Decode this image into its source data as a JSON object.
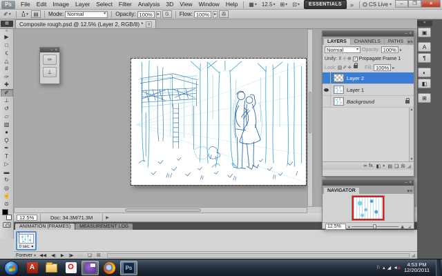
{
  "app": {
    "logo": "Ps",
    "menus": [
      "File",
      "Edit",
      "Image",
      "Layer",
      "Select",
      "Filter",
      "Analysis",
      "3D",
      "View",
      "Window",
      "Help"
    ],
    "zoom_level": "12.5",
    "bar_icons": [
      {
        "name": "view-extras-icon",
        "glyph": "▦"
      },
      {
        "name": "arrange-documents-icon",
        "glyph": "⊞"
      },
      {
        "name": "screen-mode-icon",
        "glyph": "⊡"
      }
    ],
    "workspace": "ESSENTIALS",
    "overflow": "»",
    "cslive": "CS Live",
    "window": {
      "minimize": "–",
      "restore": "❐",
      "close": "×"
    }
  },
  "options": {
    "brush_size": "11",
    "mode_label": "Mode:",
    "mode_value": "Normal",
    "opacity_label": "Opacity:",
    "opacity_value": "100%",
    "flow_label": "Flow:",
    "flow_value": "100%",
    "brush_glyph": "✐",
    "panel_toggle_glyph": "▤",
    "airbrush_glyph": "✇",
    "pressure_glyph": "⍉"
  },
  "doc_tab": {
    "title": "Composite rough.psd @ 12.5% (Layer 2, RGB/8) *",
    "close": "×"
  },
  "tools": [
    {
      "name": "move-tool",
      "glyph": "▶"
    },
    {
      "name": "marquee-tool",
      "glyph": "□"
    },
    {
      "name": "lasso-tool",
      "glyph": "ς"
    },
    {
      "name": "quick-selection-tool",
      "glyph": "△"
    },
    {
      "name": "crop-tool",
      "glyph": "#"
    },
    {
      "name": "eyedropper-tool",
      "glyph": "✑"
    },
    {
      "name": "healing-brush-tool",
      "glyph": "✚"
    },
    {
      "name": "brush-tool",
      "glyph": "✐"
    },
    {
      "name": "clone-stamp-tool",
      "glyph": "⊥"
    },
    {
      "name": "history-brush-tool",
      "glyph": "↺"
    },
    {
      "name": "eraser-tool",
      "glyph": "▱"
    },
    {
      "name": "gradient-tool",
      "glyph": "▧"
    },
    {
      "name": "blur-tool",
      "glyph": "●"
    },
    {
      "name": "dodge-tool",
      "glyph": "Ϙ"
    },
    {
      "name": "pen-tool",
      "glyph": "✒"
    },
    {
      "name": "type-tool",
      "glyph": "T"
    },
    {
      "name": "path-selection-tool",
      "glyph": "▷"
    },
    {
      "name": "shape-tool",
      "glyph": "▬"
    },
    {
      "name": "rotate-3d-tool",
      "glyph": "↻"
    },
    {
      "name": "camera-3d-tool",
      "glyph": "◎"
    },
    {
      "name": "hand-tool",
      "glyph": "☝"
    },
    {
      "name": "zoom-tool",
      "glyph": "⊙"
    }
  ],
  "mini_panel": {
    "icons": [
      {
        "name": "brush-panel-icon",
        "glyph": "✑"
      },
      {
        "name": "tool-presets-panel-icon",
        "glyph": "⊥"
      }
    ]
  },
  "layers_panel": {
    "tabs": [
      "LAYERS",
      "CHANNELS",
      "PATHS"
    ],
    "blend_mode": "Normal",
    "opacity_label": "Opacity:",
    "opacity_value": "100%",
    "unify_label": "Unify:",
    "unify_icons": [
      "⊼",
      "⊹",
      "⊕"
    ],
    "propagate_check": "✓",
    "propagate_label": "Propagate Frame 1",
    "lock_label": "Lock:",
    "lock_icons": [
      "▨",
      "✐",
      "✛"
    ],
    "fill_label": "Fill:",
    "fill_value": "100%",
    "layers": [
      {
        "name": "Layer 2"
      },
      {
        "name": "Layer 1"
      },
      {
        "name": "Background"
      }
    ],
    "bottom_icons": [
      {
        "name": "link-layers-icon",
        "glyph": "∞"
      },
      {
        "name": "layer-style-icon",
        "glyph": "fx."
      },
      {
        "name": "add-mask-icon",
        "glyph": "◧"
      },
      {
        "name": "adjustment-layer-icon",
        "glyph": "◐"
      },
      {
        "name": "new-group-icon",
        "glyph": "▤"
      },
      {
        "name": "new-layer-icon",
        "glyph": "❏"
      },
      {
        "name": "delete-layer-icon",
        "glyph": "☒"
      }
    ]
  },
  "navigator": {
    "title": "NAVIGATOR",
    "zoom": "12.5%"
  },
  "dock_icons": [
    {
      "name": "history-panel-icon",
      "glyph": "▣"
    },
    {
      "name": "character-panel-icon",
      "glyph": "A"
    },
    {
      "name": "paragraph-panel-icon",
      "glyph": "¶"
    },
    {
      "name": "adjustments-panel-icon",
      "glyph": "◐"
    },
    {
      "name": "masks-panel-icon",
      "glyph": "◧"
    },
    {
      "name": "clone-source-panel-icon",
      "glyph": "⊞"
    }
  ],
  "status": {
    "zoom": "12.5%",
    "doc_size": "Doc: 34.3M/71.3M",
    "menu_arrow": "▶"
  },
  "animation": {
    "tab_frames": "ANIMATION (FRAMES)",
    "tab_measure": "MEASUREMENT LOG",
    "frame_number": "1",
    "frame_delay": "0 sec. ▾",
    "loop_value": "Forever",
    "playback": [
      {
        "name": "first-frame-button",
        "glyph": "◀◀"
      },
      {
        "name": "prev-frame-button",
        "glyph": "◀|"
      },
      {
        "name": "play-button",
        "glyph": "▶"
      },
      {
        "name": "next-frame-button",
        "glyph": "|▶"
      },
      {
        "name": "tween-button",
        "glyph": "⋯"
      },
      {
        "name": "duplicate-frame-button",
        "glyph": "❏"
      },
      {
        "name": "delete-frame-button",
        "glyph": "☒"
      }
    ]
  },
  "taskbar": {
    "apps": [
      {
        "name": "adobe-reader",
        "label": "A"
      },
      {
        "name": "explorer",
        "label": ""
      },
      {
        "name": "opera",
        "label": "O"
      },
      {
        "name": "messenger",
        "label": ""
      },
      {
        "name": "firefox",
        "label": ""
      },
      {
        "name": "photoshop",
        "label": "Ps"
      }
    ],
    "tray_icons": [
      {
        "name": "action-center-flag-icon",
        "glyph": "⚐"
      },
      {
        "name": "hidden-icons-chevron",
        "glyph": "▴"
      },
      {
        "name": "network-icon",
        "glyph": "◢"
      },
      {
        "name": "volume-muted-icon",
        "glyph": "◄"
      }
    ],
    "mute_x": "×",
    "time": "4:53 PM",
    "date": "12/20/2011"
  },
  "colors": {
    "selection_blue": "#3c7dd4",
    "proxy_border": "#e01b1b",
    "sketch_cyan": "#54b8dc",
    "sketch_blue": "#366fae",
    "close_red": "#c4402c"
  }
}
